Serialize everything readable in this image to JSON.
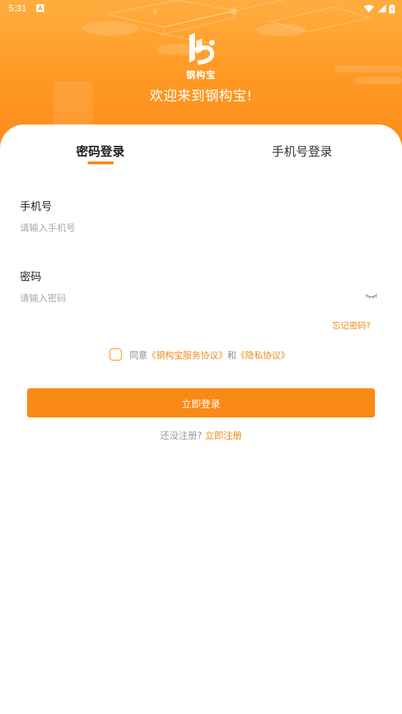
{
  "status_bar": {
    "time": "5:31",
    "notification_icon": "notification-a-icon",
    "wifi_icon": "wifi-icon",
    "signal_icon": "signal-icon",
    "battery_icon": "battery-icon"
  },
  "header": {
    "logo_icon": "gougoubao-logo-icon",
    "logo_text": "钢构宝",
    "welcome": "欢迎来到钢构宝!"
  },
  "tabs": [
    {
      "label": "密码登录",
      "active": true
    },
    {
      "label": "手机号登录",
      "active": false
    }
  ],
  "form": {
    "phone": {
      "label": "手机号",
      "placeholder": "请输入手机号",
      "value": ""
    },
    "password": {
      "label": "密码",
      "placeholder": "请输入密码",
      "value": "",
      "toggle_icon": "eye-closed-icon"
    },
    "forgot": "忘记密码?"
  },
  "agreement": {
    "checked": false,
    "prefix": "同意",
    "service_link": "《钢构宝服务协议》",
    "conjunction": "和",
    "privacy_link": "《隐私协议》"
  },
  "actions": {
    "login": "立即登录",
    "register_hint": "还没注册?",
    "register_link": "立即注册"
  },
  "colors": {
    "accent": "#fa8a16",
    "header_top": "#ffad3f",
    "header_bottom": "#fb8a18",
    "link": "#f08a1c"
  }
}
